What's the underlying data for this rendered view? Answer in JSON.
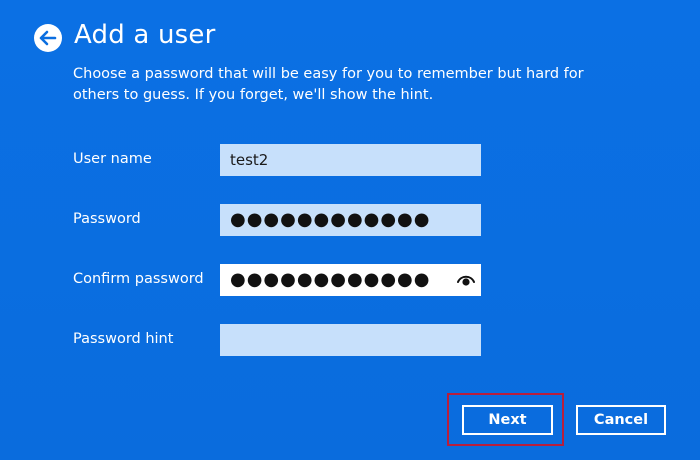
{
  "header": {
    "title": "Add a user",
    "back_icon": "back-arrow-icon"
  },
  "description": "Choose a password that will be easy for you to remember but hard for others to guess. If you forget, we'll show the hint.",
  "form": {
    "username": {
      "label": "User name",
      "value": "test2"
    },
    "password": {
      "label": "Password",
      "value": "●●●●●●●●●●●●"
    },
    "confirm_password": {
      "label": "Confirm password",
      "value": "●●●●●●●●●●●●",
      "reveal_icon": "eye-icon"
    },
    "password_hint": {
      "label": "Password hint",
      "value": ""
    }
  },
  "buttons": {
    "next_label": "Next",
    "cancel_label": "Cancel"
  },
  "colors": {
    "background": "#0a6ddf",
    "input_background": "#c7e0fb",
    "highlight_border": "#b81e3c"
  }
}
